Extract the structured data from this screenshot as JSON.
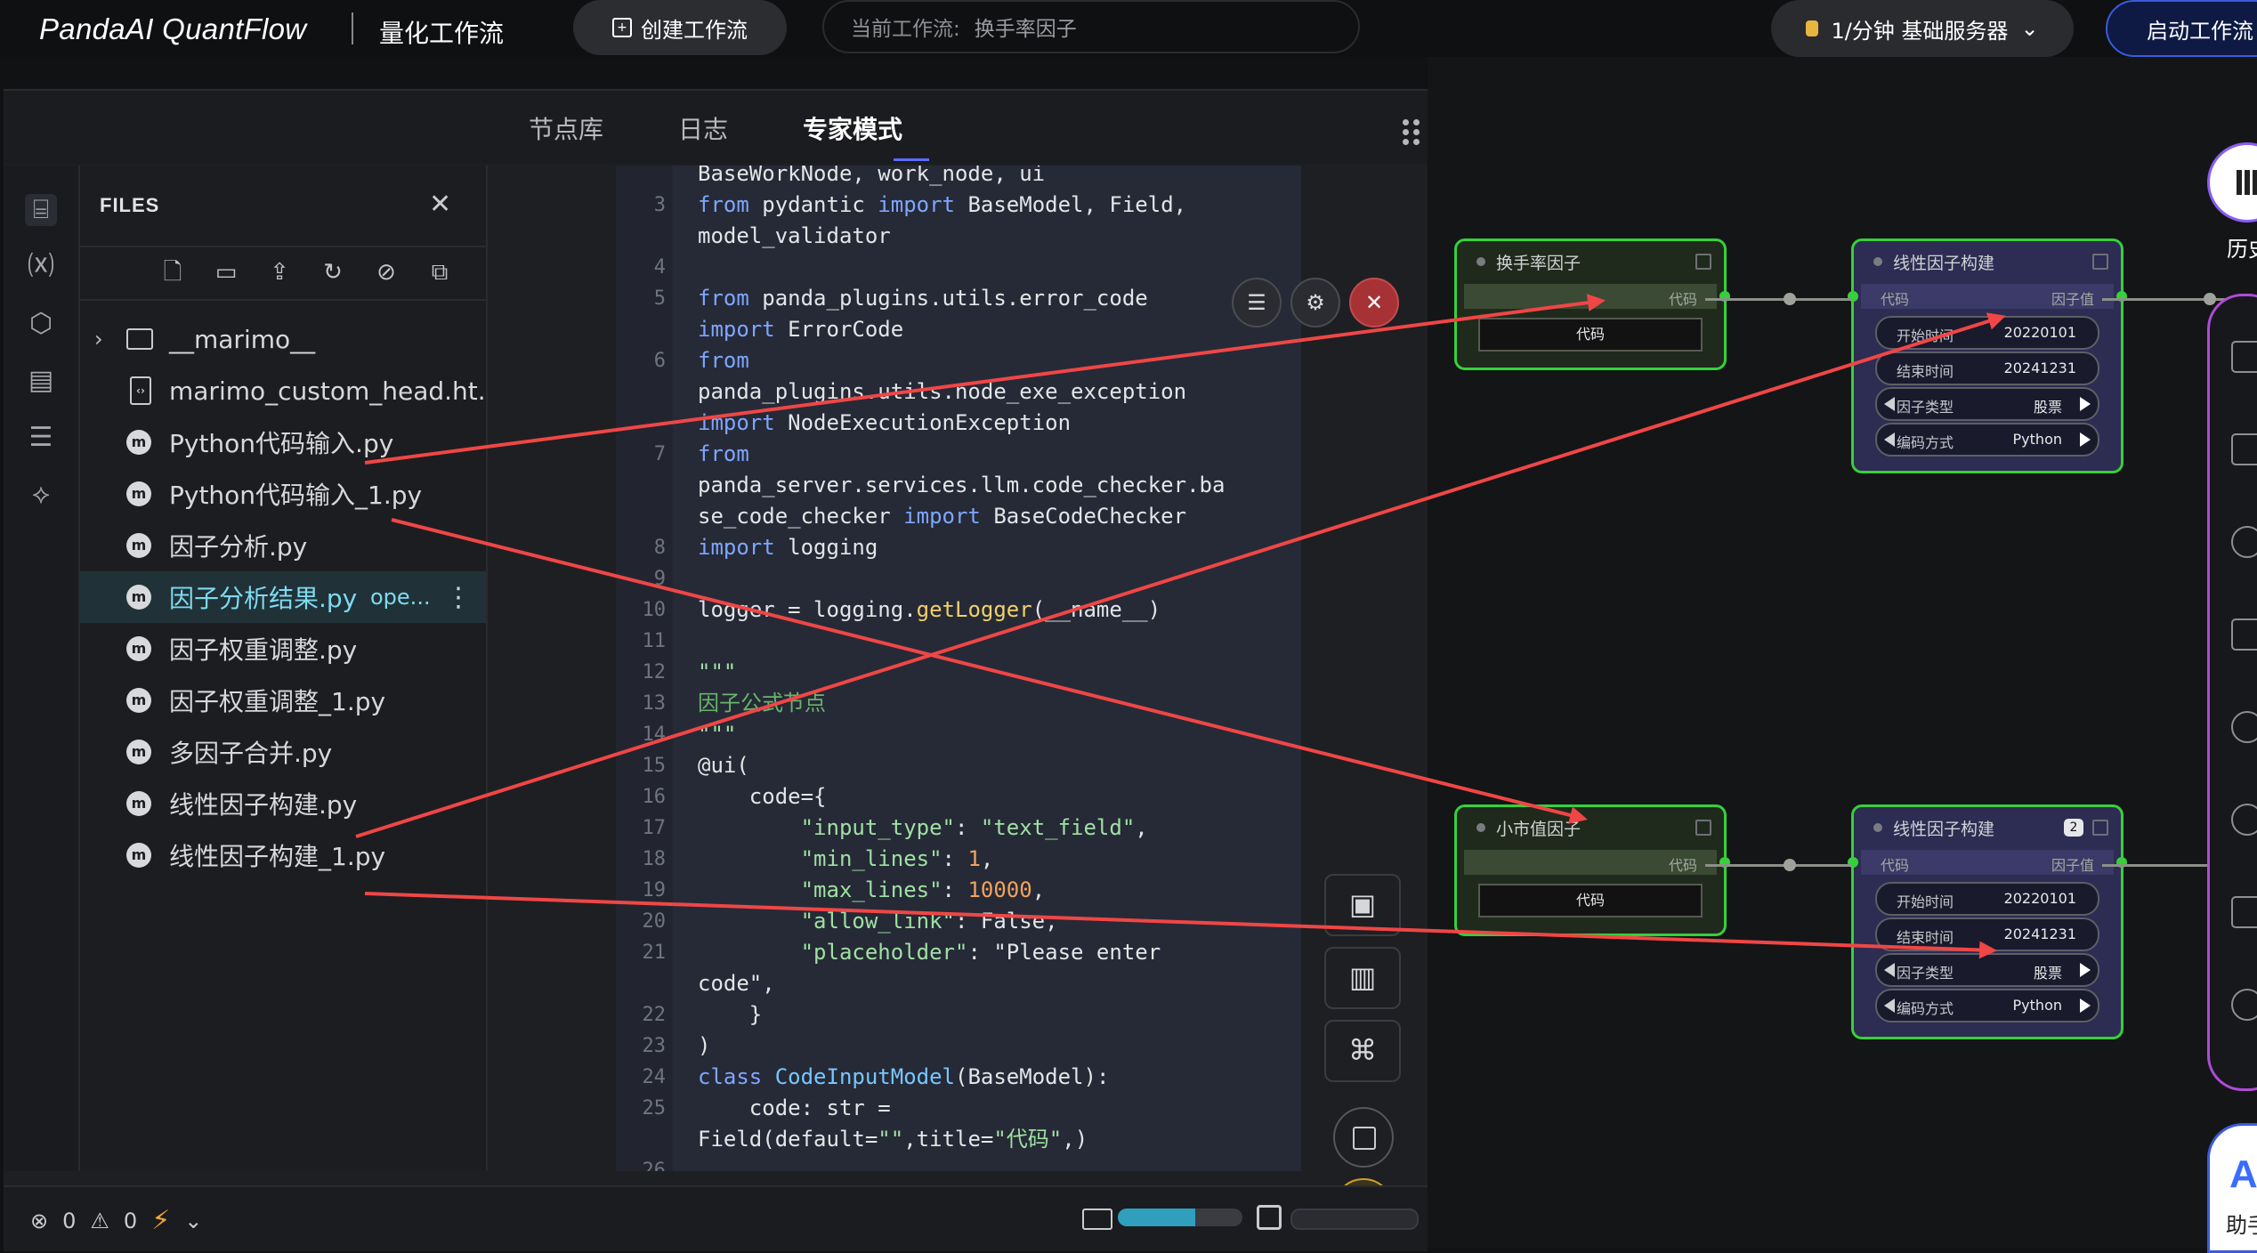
{
  "topbar": {
    "brand": "PandaAI QuantFlow",
    "brand_sub": "量化工作流",
    "create_label": "创建工作流",
    "current_label": "当前工作流:",
    "current_value": "换手率因子",
    "server_label": "1/分钟  基础服务器",
    "start_label": "启动工作流"
  },
  "panel": {
    "tabs": [
      "节点库",
      "日志",
      "专家模式"
    ],
    "active_tab": 2
  },
  "files": {
    "title": "FILES",
    "items": [
      {
        "name": "__marimo__",
        "type": "folder"
      },
      {
        "name": "marimo_custom_head.ht...",
        "type": "doc"
      },
      {
        "name": "Python代码输入.py",
        "type": "marimo"
      },
      {
        "name": "Python代码输入_1.py",
        "type": "marimo"
      },
      {
        "name": "因子分析.py",
        "type": "marimo"
      },
      {
        "name": "因子分析结果.py",
        "type": "marimo",
        "selected": true,
        "suffix": "ope..."
      },
      {
        "name": "因子权重调整.py",
        "type": "marimo"
      },
      {
        "name": "因子权重调整_1.py",
        "type": "marimo"
      },
      {
        "name": "多因子合并.py",
        "type": "marimo"
      },
      {
        "name": "线性因子构建.py",
        "type": "marimo"
      },
      {
        "name": "线性因子构建_1.py",
        "type": "marimo"
      }
    ]
  },
  "code": {
    "lines": [
      {
        "n": "",
        "t": "BaseWorkNode, work_node, ui"
      },
      {
        "n": "3",
        "t": "from pydantic import BaseModel, Field,"
      },
      {
        "n": "",
        "t": "model_validator"
      },
      {
        "n": "4",
        "t": ""
      },
      {
        "n": "5",
        "t": "from panda_plugins.utils.error_code"
      },
      {
        "n": "",
        "t": "import ErrorCode"
      },
      {
        "n": "6",
        "t": "from"
      },
      {
        "n": "",
        "t": "panda_plugins.utils.node_exe_exception"
      },
      {
        "n": "",
        "t": "import NodeExecutionException"
      },
      {
        "n": "7",
        "t": "from"
      },
      {
        "n": "",
        "t": "panda_server.services.llm.code_checker.ba"
      },
      {
        "n": "",
        "t": "se_code_checker import BaseCodeChecker"
      },
      {
        "n": "8",
        "t": "import logging"
      },
      {
        "n": "9",
        "t": ""
      },
      {
        "n": "10",
        "t": "logger = logging.getLogger(__name__)"
      },
      {
        "n": "11",
        "t": ""
      },
      {
        "n": "12",
        "t": "\"\"\""
      },
      {
        "n": "13",
        "t": "因子公式节点"
      },
      {
        "n": "14",
        "t": "\"\"\""
      },
      {
        "n": "15",
        "t": "@ui("
      },
      {
        "n": "16",
        "t": "    code={"
      },
      {
        "n": "17",
        "t": "        \"input_type\": \"text_field\","
      },
      {
        "n": "18",
        "t": "        \"min_lines\": 1,"
      },
      {
        "n": "19",
        "t": "        \"max_lines\": 10000,"
      },
      {
        "n": "20",
        "t": "        \"allow_link\": False,"
      },
      {
        "n": "21",
        "t": "        \"placeholder\": \"Please enter"
      },
      {
        "n": "",
        "t": "code\","
      },
      {
        "n": "22",
        "t": "    }"
      },
      {
        "n": "23",
        "t": ")"
      },
      {
        "n": "24",
        "t": "class CodeInputModel(BaseModel):"
      },
      {
        "n": "25",
        "t": "    code: str ="
      },
      {
        "n": "",
        "t": "Field(default=\"\",title=\"代码\",)"
      },
      {
        "n": "26",
        "t": ""
      }
    ]
  },
  "status": {
    "errors": "0",
    "warnings": "0",
    "memory_progress": 0.62
  },
  "nodes": {
    "n1": {
      "title": "换手率因子",
      "out": "代码",
      "box": "代码"
    },
    "n2": {
      "title": "线性因子构建",
      "in": "代码",
      "out": "因子值",
      "start_label": "开始时间",
      "start": "20220101",
      "end_label": "结束时间",
      "end": "20241231",
      "type_label": "因子类型",
      "type": "股票",
      "enc_label": "编码方式",
      "enc": "Python"
    },
    "n3": {
      "title": "小市值因子",
      "out": "代码",
      "box": "代码"
    },
    "n4": {
      "title": "线性因子构建",
      "badge": "2",
      "in": "代码",
      "out": "因子值",
      "start_label": "开始时间",
      "start": "20220101",
      "end_label": "结束时间",
      "end": "20241231",
      "type_label": "因子类型",
      "type": "股票",
      "enc_label": "编码方式",
      "enc": "Python"
    }
  },
  "dock": {
    "history_label": "历史",
    "assistant_letter": "A",
    "assistant_label": "助手"
  },
  "colors": {
    "node_border": "#35d13a",
    "arrow": "#f04646",
    "accent": "#3b5bdb"
  }
}
